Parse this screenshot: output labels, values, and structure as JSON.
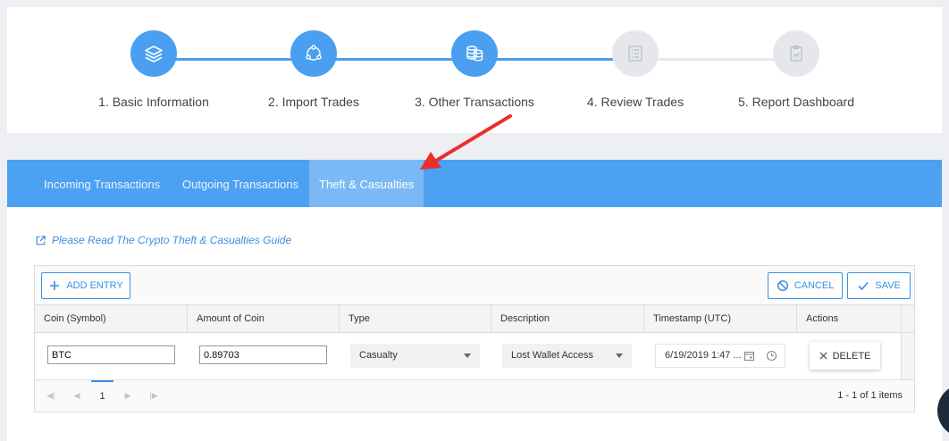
{
  "stepper": {
    "steps": [
      {
        "label": "1. Basic Information",
        "icon": "layers-icon",
        "state": "complete"
      },
      {
        "label": "2. Import Trades",
        "icon": "sync-icon",
        "state": "complete"
      },
      {
        "label": "3. Other Transactions",
        "icon": "coins-icon",
        "state": "active"
      },
      {
        "label": "4. Review Trades",
        "icon": "list-icon",
        "state": "pending"
      },
      {
        "label": "5. Report Dashboard",
        "icon": "report-icon",
        "state": "pending"
      }
    ],
    "colors": {
      "active": "#4a9ff0",
      "pending": "#e5e7ec",
      "pending_icon": "#b9bec8"
    }
  },
  "tabs": {
    "items": [
      "Incoming Transactions",
      "Outgoing Transactions",
      "Theft & Casualties"
    ],
    "active": "Theft & Casualties",
    "bar_color": "#4da1f2"
  },
  "guide_link": "Please Read The Crypto Theft & Casualties Guide",
  "grid": {
    "toolbar": {
      "add": "ADD ENTRY",
      "cancel": "CANCEL",
      "save": "SAVE"
    },
    "columns": [
      "Coin (Symbol)",
      "Amount of Coin",
      "Type",
      "Description",
      "Timestamp (UTC)",
      "Actions"
    ],
    "row": {
      "coin": "BTC",
      "amount": "0.89703",
      "type": "Casualty",
      "description": "Lost Wallet Access",
      "timestamp": "6/19/2019 1:47 ...",
      "action": "DELETE"
    },
    "pager": {
      "page": "1",
      "info": "1 - 1 of 1 items"
    }
  },
  "annotation": {
    "arrow_color": "#e8302a"
  }
}
